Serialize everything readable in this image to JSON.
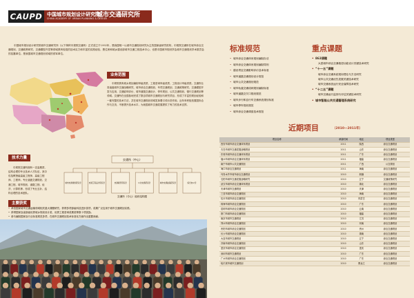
{
  "header": {
    "logo": "CAUPD",
    "institute_cn": "中国城市规划设计研究院",
    "institute_en": "CHINA ACADEMY OF URBAN PLANNING & DESIGN",
    "department": "城市交通研究所"
  },
  "intro": "中国城市规划设计研究院城市交通研究所（以下简称中规院交通所）正式成立于1992年，是我国唯一以城市交通规划研究为主的国家级研究机构，中规院交通所在城市综合交通规划、交通政策研究、交通模型开发等领域具有较强的技术实力和丰富的实践经验，是住房和城乡建设部城市交通工程技术中心，也是中国城市规划学会城市交通规划学术委员会的挂靠单位，是我国城市交通规划领域的领军单位。",
  "business": {
    "label": "业务范围",
    "text": "中规院具有城乡规划编制甲级资质、工程咨询甲级资质、工程设计甲级资质。交通所业务涵盖城市交通战略研究、城市综合交通规划、专项交通规划、交通政策研究、交通模型开发与应用、交通影响评价、城市道路交通设计、停车规划、公共交通规划、慢行交通规划等领域。交通所在全国各地完成了数百项城市交通规划与研究项目，形成了丰富的规划经验和一套完整的技术方法，并在城市交通规划领域发挥着引领示范作用。近年来积极拓展国际合作与交流，不断提升技术水平，为我国城市交通发展提供了有力的技术支撑。"
  },
  "technical": {
    "label": "技术力量",
    "text": "中规院交通所拥有一支高素质、结构合理的专业技术人才队伍，其中包括教授级高级工程师、高级工程师、工程师，专业涵盖交通规划、交通工程、城市规划、道路工程、经济、计算机等，形成了专业互补、结构合理的技术团队。"
  },
  "org_chart": {
    "top": "交通所（中心）",
    "branches": [
      "城市交通规划研究室",
      "交通工程设计研究室",
      "交通模型研究室",
      "公共交通研究室",
      "城市交通政策研究室",
      "综合办公室"
    ],
    "caption": "交通所（中心）组织结构图"
  },
  "achievements": {
    "label": "主要获奖",
    "items": [
      "承担国家城市交通运输领域相关重大课题研究，获得多项部级科技进步奖项，成果广泛应用于城市交通规划实践。",
      "获得国家及省部级优秀城乡规划设计奖、优秀工程咨询成果奖等数十项奖励。",
      "参与编制国家及行业标准规范多项，在城市交通规划技术标准化方面作出重要贡献。",
      "在城市综合交通规划、交通政策研究等领域成果丰硕，部分成果获得国际学术界认可。"
    ]
  },
  "standards": {
    "title": "标准规范",
    "items": [
      "城市综合交通体系规划编制办法",
      "城市综合交通体系规划编制导则",
      "建设项目交通影响评价技术标准",
      "城市道路交通规划设计规范",
      "城市公共交通规划规范",
      "城市轨道交通线网规划编制标准",
      "城市道路交叉口规划规范",
      "城市步行和自行车交通系统规划标准",
      "城市停车规划规范",
      "城市综合交通调查技术规范"
    ]
  },
  "key_projects": {
    "title": "重点课题",
    "items": [
      {
        "text": "863课题",
        "hd": true
      },
      {
        "text": "大型城市综合交通枢纽功能设计关键技术研究",
        "sub": true
      },
      {
        "text": "“十一五”课题",
        "hd": true
      },
      {
        "text": "城市综合交通系统规划理论与方法研究",
        "sub": true
      },
      {
        "text": "城市公共交通优先发展关键技术研究",
        "sub": true
      },
      {
        "text": "城市交通系统运行安全保障技术研究",
        "sub": true
      },
      {
        "text": "“十二五”课题",
        "hd": true
      },
      {
        "text": "城市交通运行监测与评估关键技术研究",
        "sub": true
      },
      {
        "text": "城市智能公共交通管理系统研究",
        "hd": true
      }
    ]
  },
  "recent_projects": {
    "title": "近期项目",
    "years": "（2010—2011年）",
    "columns": [
      "项目名称",
      "承接时间",
      "地区",
      "项目类型"
    ],
    "rows": [
      [
        "西安市城市综合交通体系规划",
        "2011",
        "陕西",
        "综合交通规划"
      ],
      [
        "青岛市城市交通发展战略规划",
        "2011",
        "山东",
        "综合交通规划"
      ],
      [
        "东莞市城市综合交通体系规划",
        "2011",
        "广东",
        "综合交通规划"
      ],
      [
        "福州市城市综合交通体系规划",
        "2011",
        "福建",
        "综合交通规划"
      ],
      [
        "南宁市城市公共交通规划",
        "2011",
        "广西",
        "公交规划"
      ],
      [
        "海口市综合交通规划",
        "2011",
        "海南",
        "综合交通规划"
      ],
      [
        "乌鲁木齐市城市综合交通规划",
        "2010",
        "新疆",
        "综合交通规划"
      ],
      [
        "沈阳市城市交通发展战略研究",
        "2010",
        "辽宁",
        "交通政策研究"
      ],
      [
        "武汉市城市综合交通体系规划",
        "2010",
        "湖北",
        "综合交通规划"
      ],
      [
        "天津市城市交通规划",
        "2010",
        "天津",
        "综合交通规划"
      ],
      [
        "三亚市城市综合交通规划",
        "2010",
        "海南",
        "综合交通规划"
      ],
      [
        "包头市城市综合交通规划",
        "2010",
        "内蒙古",
        "综合交通规划"
      ],
      [
        "珠海市城市综合交通规划",
        "2010",
        "广东",
        "综合交通规划"
      ],
      [
        "昆明市城市综合交通规划",
        "2010",
        "云南",
        "综合交通规划"
      ],
      [
        "厦门市城市综合交通规划",
        "2010",
        "福建",
        "综合交通规划"
      ],
      [
        "南京市城市交通规划",
        "2010",
        "江苏",
        "综合交通规划"
      ],
      [
        "郑州市城市综合交通规划",
        "2010",
        "河南",
        "综合交通规划"
      ],
      [
        "贵阳市城市综合交通规划",
        "2010",
        "贵州",
        "综合交通规划"
      ],
      [
        "长沙市城市综合交通规划",
        "2010",
        "湖南",
        "综合交通规划"
      ],
      [
        "大连市城市交通规划",
        "2010",
        "辽宁",
        "综合交通规划"
      ],
      [
        "济南市城市综合交通规划",
        "2010",
        "山东",
        "综合交通规划"
      ],
      [
        "重庆市城市综合交通规划",
        "2010",
        "重庆",
        "综合交通规划"
      ],
      [
        "深圳市城市交通规划",
        "2010",
        "广东",
        "综合交通规划"
      ],
      [
        "广州市城市综合交通规划",
        "2010",
        "广东",
        "综合交通规划"
      ],
      [
        "哈尔滨市城市交通规划",
        "2010",
        "黑龙江",
        "综合交通规划"
      ]
    ]
  }
}
